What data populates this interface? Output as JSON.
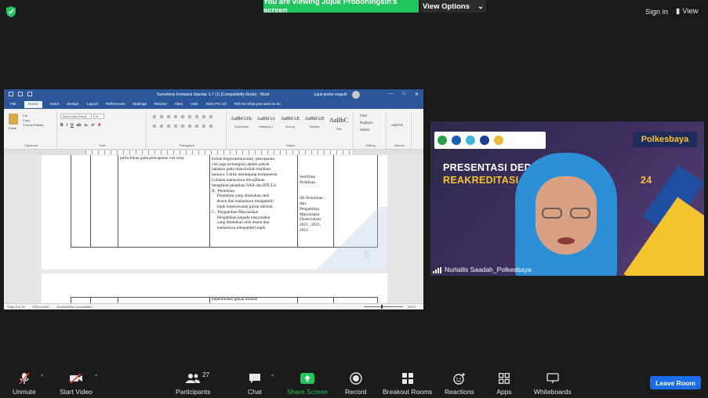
{
  "top": {
    "viewing_banner": "You are viewing Jujuk Proboningsih's screen",
    "view_options": "View Options",
    "sign_in": "Sign in",
    "view": "View"
  },
  "word": {
    "title": "Surveilens Komplesi Standar 1-7 (1) [Compatibility Mode] - Word",
    "user": "jujuk probo ningsih",
    "menu": [
      "File",
      "Home",
      "Insert",
      "Design",
      "Layout",
      "References",
      "Mailings",
      "Review",
      "View",
      "Help",
      "Nitro Pro 10",
      "Tell me what you want to do"
    ],
    "clipboard": {
      "paste": "Paste",
      "cut": "Cut",
      "copy": "Copy",
      "format_painter": "Format Painter",
      "label": "Clipboard"
    },
    "font": {
      "name": "Times New Roma",
      "size": "10",
      "label": "Font"
    },
    "paragraph_label": "Paragraph",
    "styles": [
      {
        "sample": "AaBbCcDc",
        "name": "Emphasis"
      },
      {
        "sample": "AaBbCcI",
        "name": "Heading 3"
      },
      {
        "sample": "AaBbCcE",
        "name": "Strong"
      },
      {
        "sample": "AaBbCcD",
        "name": "Subtitle"
      },
      {
        "sample": "AaBbC",
        "name": "Title"
      }
    ],
    "styles_label": "Styles",
    "editing": {
      "find": "Find",
      "replace": "Replace",
      "select": "Select",
      "label": "Editing"
    },
    "addins": {
      "name": "Add-ins",
      "label": "Add-ins"
    },
    "doc": {
      "col2_text": "perlu fokus pada pencapaian visi misi",
      "col4_text": "Selain dimplementasikan pada mata\nkuliah kegawatdaruratan, pencapaian\nvisi juga terintegrasi dalam pokok\nbahasan pada mata kuliah keahlian\nlainnya. Untuk menunjang kompetensi\nLulusan mahasiswa diwajibkan\nmengikuti pelatihan SAR dan BTCLS.\nB.  Penelitian\n     Penelitian yang dilakukan oleh\n     dosen dan mahasiswa mengambil\n     topik keperawatan gawat darurat.\nC.  Pengabdian Masyarakat\n     Pengabdian kepada masyarakat\n     yang dilakukan oleh dosen dan\n     mahasiswa mengambil topik",
      "col5_text": "Sertifikat\nPelatihan\n\n\nSK Penelitian\ndan\nPengabdian\nMasyarakat\nDosen tahun\n2021 , 2022,\n2023",
      "page_number": "8",
      "page2_text": "keperawatan gawat darurat"
    },
    "status": {
      "page": "Page 8 of 16",
      "words": "5781 words",
      "accessibility": "Accessibility: Unavailable",
      "zoom": "100%"
    }
  },
  "video": {
    "pres_line1": "PRESENTASI DEDD",
    "pres_line2": "REAKREDITASI P",
    "pres_suffix": "24",
    "brand": "Polkesbaya",
    "participant_name": "Nurlailis Saadah_Polkesbaya"
  },
  "toolbar": {
    "unmute": "Unmute",
    "start_video": "Start Video",
    "participants": "Participants",
    "participants_count": "27",
    "chat": "Chat",
    "share_screen": "Share Screen",
    "record": "Record",
    "breakout_rooms": "Breakout Rooms",
    "reactions": "Reactions",
    "apps": "Apps",
    "whiteboards": "Whiteboards",
    "leave_room": "Leave Room"
  },
  "colors": {
    "share_green": "#23c55e",
    "word_blue": "#2b579a",
    "leave_blue": "#1b6ce8",
    "brand_yellow": "#f4c430"
  }
}
